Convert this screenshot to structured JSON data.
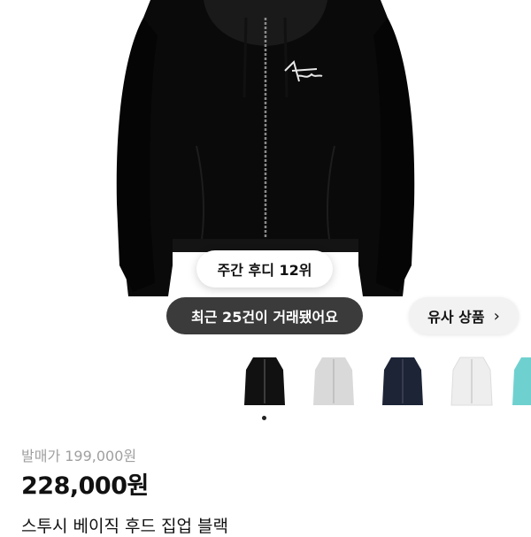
{
  "product": {
    "brand_mark": "Stüssy",
    "title": "스투시 베이직 후드 집업 블랙",
    "original_price": "발매가 199,000원",
    "price": "228,000원"
  },
  "badges": {
    "weekly_rank": "주간 후디 12위",
    "recent_trades": "최근 25건이 거래됐어요"
  },
  "similar": {
    "label": "유사 상품",
    "icon": "chevron-right-icon"
  },
  "thumbnails": [
    {
      "color": "#111111",
      "name": "black"
    },
    {
      "color": "#d9d9d9",
      "name": "ash-grey"
    },
    {
      "color": "#1c2436",
      "name": "navy"
    },
    {
      "color": "#eeeeee",
      "name": "white"
    },
    {
      "color": "#6fd1cf",
      "name": "teal"
    }
  ],
  "carousel": {
    "active_index": 0
  }
}
